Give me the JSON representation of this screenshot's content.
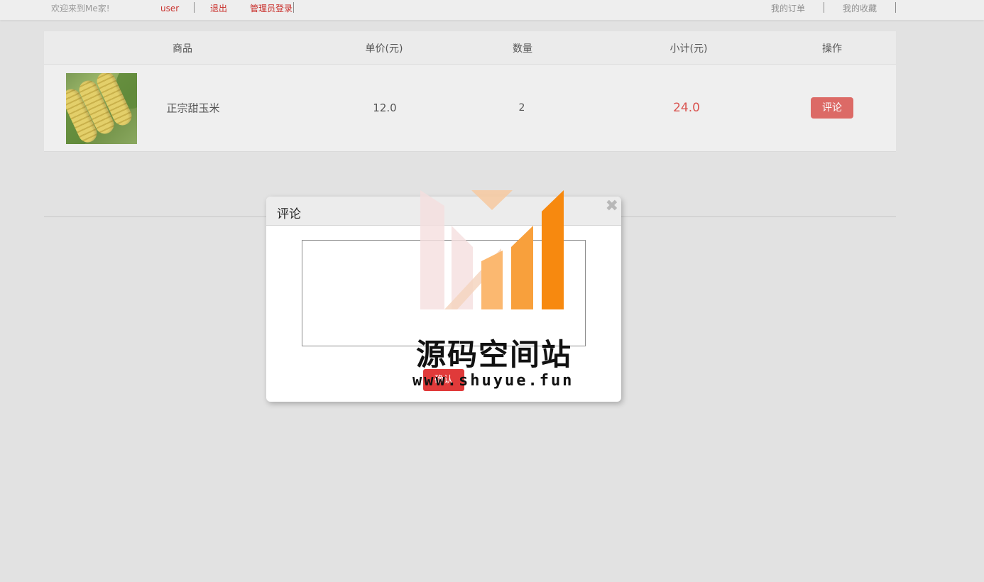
{
  "topbar": {
    "welcome": "欢迎来到Me家!",
    "username": "user",
    "logout": "退出",
    "admin_login": "管理员登录",
    "my_orders": "我的订单",
    "my_favorites": "我的收藏"
  },
  "cart": {
    "headers": {
      "product": "商品",
      "unit_price": "单价(元)",
      "quantity": "数量",
      "subtotal": "小计(元)",
      "action": "操作"
    },
    "items": [
      {
        "name": "正宗甜玉米",
        "unit_price": "12.0",
        "quantity": "2",
        "subtotal": "24.0",
        "action_label": "评论"
      }
    ]
  },
  "modal": {
    "title": "评论",
    "close_glyph": "✖",
    "comment_value": "",
    "confirm_label": "确认"
  },
  "watermark": {
    "brand": "源码空间站",
    "url": "www.shuyue.fun"
  },
  "colors": {
    "accent_red": "#d9534f",
    "link_red": "#c9302c",
    "background": "#e2e2e2"
  }
}
